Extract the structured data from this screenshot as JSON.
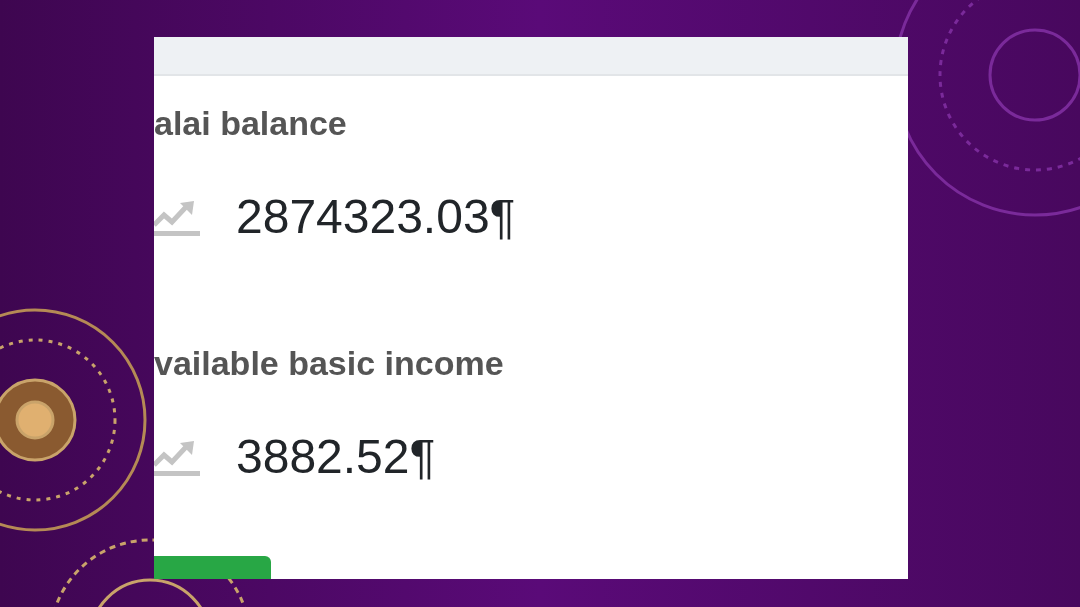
{
  "stats": [
    {
      "label": "alai balance",
      "value": "2874323.03¶"
    },
    {
      "label": "vailable basic income",
      "value": "3882.52¶"
    }
  ]
}
